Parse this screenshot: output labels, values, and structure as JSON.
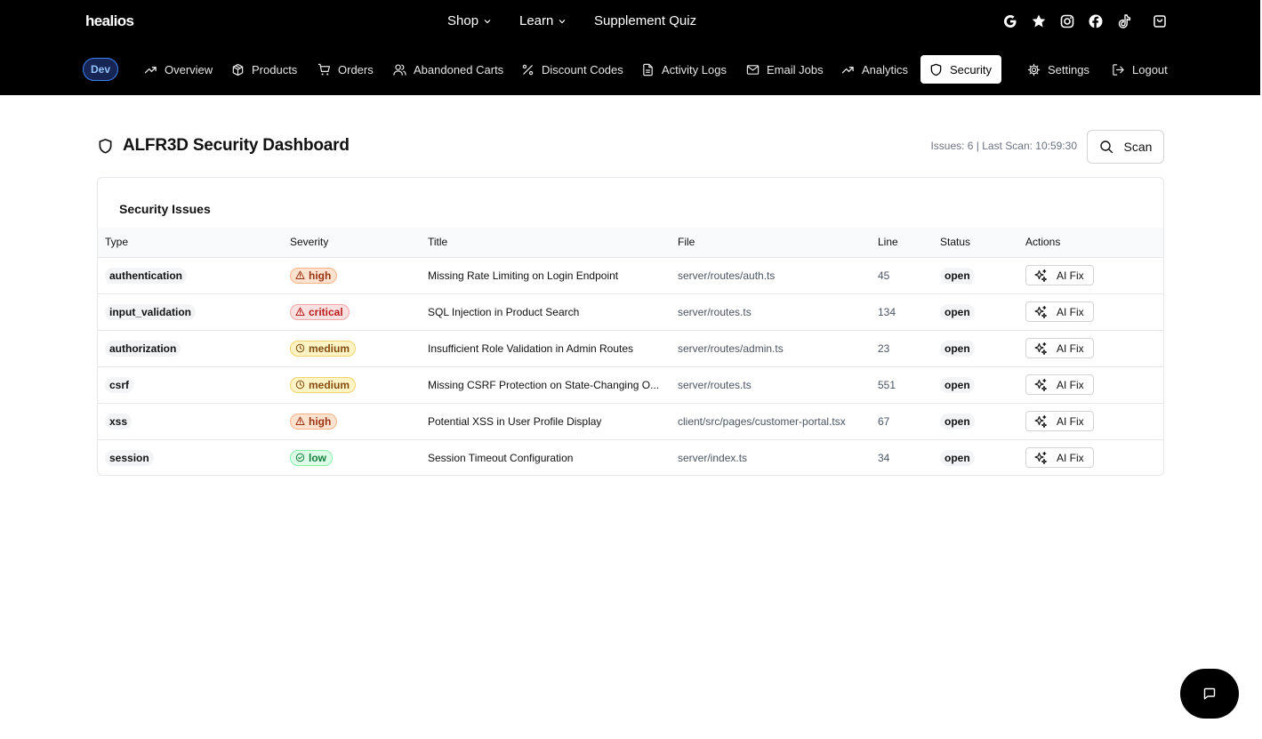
{
  "brand": {
    "logo": "healios"
  },
  "top_nav": {
    "items": [
      {
        "label": "Shop",
        "dropdown": true
      },
      {
        "label": "Learn",
        "dropdown": true
      },
      {
        "label": "Supplement Quiz",
        "dropdown": false
      }
    ],
    "social_icons": [
      "google-icon",
      "star-icon",
      "instagram-icon",
      "facebook-icon",
      "tiktok-icon",
      "shopping-bag-icon"
    ]
  },
  "admin_nav": {
    "env_badge": "Dev",
    "items": [
      {
        "label": "Overview",
        "icon": "trending-up-icon"
      },
      {
        "label": "Products",
        "icon": "package-icon"
      },
      {
        "label": "Orders",
        "icon": "cart-icon"
      },
      {
        "label": "Abandoned Carts",
        "icon": "users-icon"
      },
      {
        "label": "Discount Codes",
        "icon": "percent-icon"
      },
      {
        "label": "Activity Logs",
        "icon": "file-text-icon"
      },
      {
        "label": "Email Jobs",
        "icon": "mail-icon"
      },
      {
        "label": "Analytics",
        "icon": "trending-up-icon"
      },
      {
        "label": "Security",
        "icon": "shield-icon",
        "active": true
      },
      {
        "label": "Settings",
        "icon": "gear-icon"
      },
      {
        "label": "Logout",
        "icon": "logout-icon"
      }
    ]
  },
  "page": {
    "title": "ALFR3D Security Dashboard",
    "scan_meta": "Issues: 6 | Last Scan: 10:59:30",
    "scan_button": "Scan"
  },
  "issues": {
    "title": "Security Issues",
    "columns": [
      "Type",
      "Severity",
      "Title",
      "File",
      "Line",
      "Status",
      "Actions"
    ],
    "action_label": "AI Fix",
    "rows": [
      {
        "type": "authentication",
        "severity": "high",
        "title": "Missing Rate Limiting on Login Endpoint",
        "file": "server/routes/auth.ts",
        "line": "45",
        "status": "open"
      },
      {
        "type": "input_validation",
        "severity": "critical",
        "title": "SQL Injection in Product Search",
        "file": "server/routes.ts",
        "line": "134",
        "status": "open"
      },
      {
        "type": "authorization",
        "severity": "medium",
        "title": "Insufficient Role Validation in Admin Routes",
        "file": "server/routes/admin.ts",
        "line": "23",
        "status": "open"
      },
      {
        "type": "csrf",
        "severity": "medium",
        "title": "Missing CSRF Protection on State-Changing O...",
        "file": "server/routes.ts",
        "line": "551",
        "status": "open"
      },
      {
        "type": "xss",
        "severity": "high",
        "title": "Potential XSS in User Profile Display",
        "file": "client/src/pages/customer-portal.tsx",
        "line": "67",
        "status": "open"
      },
      {
        "type": "session",
        "severity": "low",
        "title": "Session Timeout Configuration",
        "file": "server/index.ts",
        "line": "34",
        "status": "open"
      }
    ]
  },
  "colors": {
    "topbar": "#000000",
    "high": "#9a3412",
    "critical": "#b91c1c",
    "medium": "#854d0e",
    "low": "#15803d"
  }
}
